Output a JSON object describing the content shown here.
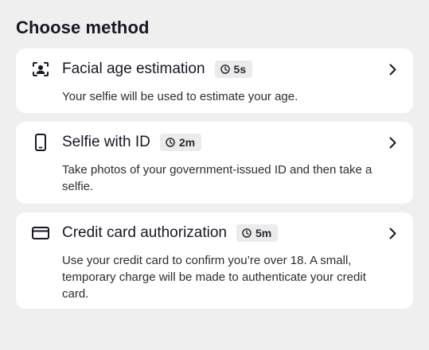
{
  "heading": "Choose method",
  "methods": [
    {
      "title": "Facial age estimation",
      "time": "5s",
      "description": "Your selfie will be used to estimate your age.",
      "icon": "face-scan-icon"
    },
    {
      "title": "Selfie with ID",
      "time": "2m",
      "description": "Take photos of your government-issued ID and then take a selfie.",
      "icon": "phone-icon"
    },
    {
      "title": "Credit card authorization",
      "time": "5m",
      "description": "Use your credit card to confirm you’re over 18. A small, temporary charge will be made to authenticate your credit card.",
      "icon": "credit-card-icon"
    }
  ],
  "colors": {
    "background": "#efefef",
    "card": "#ffffff",
    "text": "#161823",
    "badge": "#ebebeb"
  }
}
